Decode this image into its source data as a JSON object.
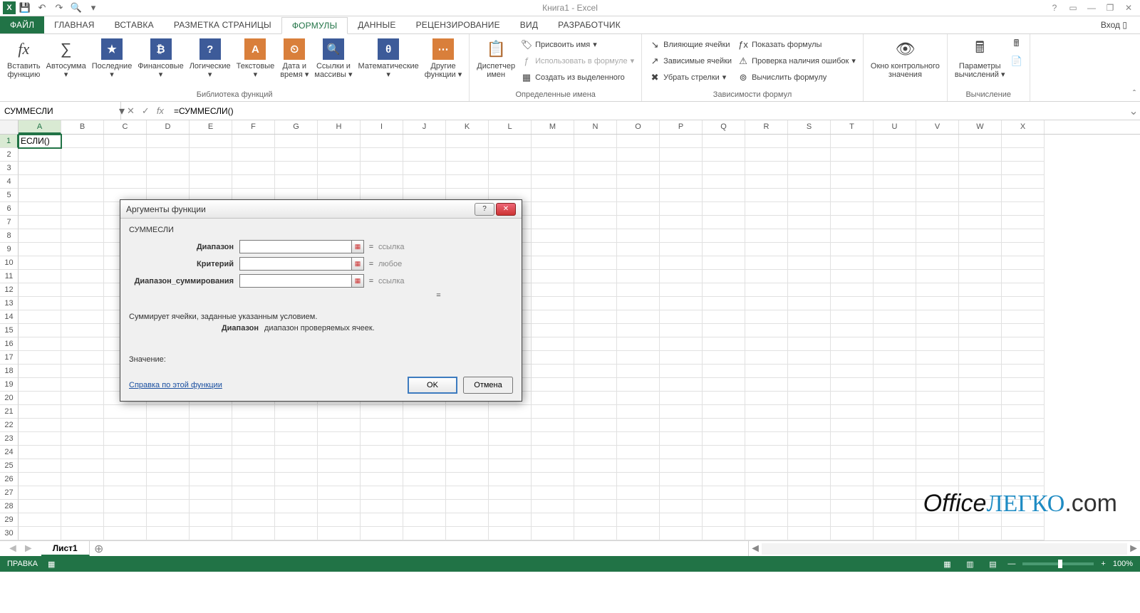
{
  "title": "Книга1 - Excel",
  "login": "Вход",
  "qat": {
    "save": "💾",
    "undo": "↶",
    "redo": "↷",
    "preview": "🔍"
  },
  "win": {
    "help": "?",
    "ribbon_opts": "▭",
    "min": "—",
    "restore": "❐",
    "close": "✕"
  },
  "tabs": [
    "ФАЙЛ",
    "ГЛАВНАЯ",
    "ВСТАВКА",
    "РАЗМЕТКА СТРАНИЦЫ",
    "ФОРМУЛЫ",
    "ДАННЫЕ",
    "РЕЦЕНЗИРОВАНИЕ",
    "ВИД",
    "РАЗРАБОТЧИК"
  ],
  "active_tab_index": 4,
  "ribbon": {
    "group_library_label": "Библиотека функций",
    "group_names_label": "Определенные имена",
    "group_audit_label": "Зависимости формул",
    "group_calc_label": "Вычисление",
    "insert_fn": "Вставить\nфункцию",
    "autosum": "Автосумма",
    "recent": "Последние",
    "financial": "Финансовые",
    "logical": "Логические",
    "text": "Текстовые",
    "datetime": "Дата и\nвремя",
    "lookup": "Ссылки и\nмассивы",
    "math": "Математические",
    "more": "Другие\nфункции",
    "name_mgr": "Диспетчер\nимен",
    "define_name": "Присвоить имя",
    "use_in_formula": "Использовать в формуле",
    "create_from_sel": "Создать из выделенного",
    "trace_prec": "Влияющие ячейки",
    "trace_dep": "Зависимые ячейки",
    "remove_arrows": "Убрать стрелки",
    "show_formulas": "Показать формулы",
    "error_check": "Проверка наличия ошибок",
    "eval_formula": "Вычислить формулу",
    "watch": "Окно контрольного\nзначения",
    "calc_opts": "Параметры\nвычислений",
    "fx_glyph": "fx"
  },
  "formula_bar": {
    "name_box": "СУММЕСЛИ",
    "cancel": "✕",
    "enter": "✓",
    "fx": "fx",
    "formula": "=СУММЕСЛИ()"
  },
  "grid": {
    "columns": [
      "A",
      "B",
      "C",
      "D",
      "E",
      "F",
      "G",
      "H",
      "I",
      "J",
      "K",
      "L",
      "M",
      "N",
      "O",
      "P",
      "Q",
      "R",
      "S",
      "T",
      "U",
      "V",
      "W",
      "X"
    ],
    "visible_rows": 30,
    "active_cell": {
      "row": 1,
      "col": "A",
      "display": "ЕСЛИ()"
    }
  },
  "sheet_bar": {
    "sheets": [
      "Лист1"
    ],
    "active": 0,
    "add": "⊕"
  },
  "status": {
    "mode": "ПРАВКА",
    "zoom": "100%"
  },
  "dialog": {
    "title": "Аргументы функции",
    "function_name": "СУММЕСЛИ",
    "args": [
      {
        "label": "Диапазон",
        "value": "",
        "hint": "ссылка"
      },
      {
        "label": "Критерий",
        "value": "",
        "hint": "любое"
      },
      {
        "label": "Диапазон_суммирования",
        "value": "",
        "hint": "ссылка"
      }
    ],
    "result_eq": "=",
    "desc": "Суммирует ячейки, заданные указанным условием.",
    "arg_desc_label": "Диапазон",
    "arg_desc_text": "диапазон проверяемых ячеек.",
    "value_label": "Значение:",
    "help_link": "Справка по этой функции",
    "ok": "OK",
    "cancel": "Отмена",
    "help_btn": "?",
    "close_btn": "✕"
  },
  "watermark": {
    "p1": "Office",
    "p2": "ЛЕГКО",
    "p3": ".com"
  }
}
